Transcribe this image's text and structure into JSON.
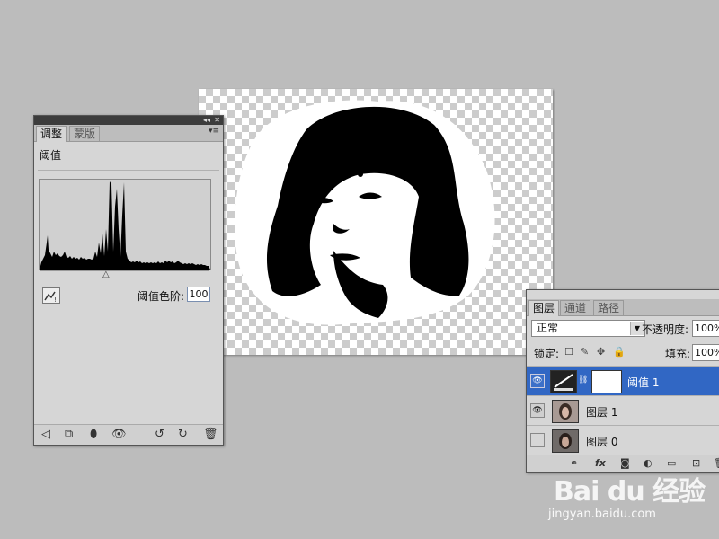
{
  "adjustments_panel": {
    "tabs": [
      "调整",
      "蒙版"
    ],
    "title": "阈值",
    "threshold_label": "阈值色阶:",
    "threshold_value": "100"
  },
  "layers_panel": {
    "tabs": [
      "图层",
      "通道",
      "路径"
    ],
    "blend_mode": "正常",
    "opacity_label": "不透明度:",
    "opacity_value": "100%",
    "lock_label": "锁定:",
    "fill_label": "填充:",
    "fill_value": "100%",
    "layers": [
      {
        "name": "阈值 1",
        "selected": true,
        "visible": true
      },
      {
        "name": "图层 1",
        "selected": false,
        "visible": true
      },
      {
        "name": "图层 0",
        "selected": false,
        "visible": false
      }
    ]
  },
  "watermark": {
    "brand": "Bai du 经验",
    "url": "jingyan.baidu.com"
  },
  "colors": {
    "selection": "#3167c4",
    "workspace": "#bcbcbc"
  }
}
